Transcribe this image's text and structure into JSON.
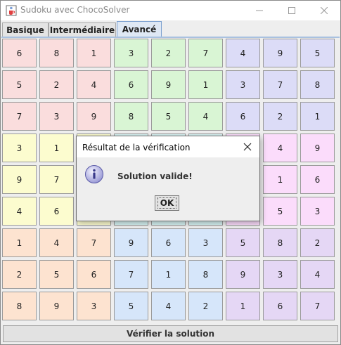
{
  "window": {
    "title": "Sudoku avec ChocoSolver",
    "icon": "java-coffee-cup-icon"
  },
  "tabs": [
    {
      "label": "Basique",
      "active": false
    },
    {
      "label": "Intermédiaire",
      "active": false
    },
    {
      "label": "Avancé",
      "active": true
    }
  ],
  "grid": {
    "rows": [
      [
        "6",
        "8",
        "1",
        "3",
        "2",
        "7",
        "4",
        "9",
        "5"
      ],
      [
        "5",
        "2",
        "4",
        "6",
        "9",
        "1",
        "3",
        "7",
        "8"
      ],
      [
        "7",
        "3",
        "9",
        "8",
        "5",
        "4",
        "6",
        "2",
        "1"
      ],
      [
        "3",
        "1",
        "",
        "",
        "",
        "",
        "",
        "4",
        "9"
      ],
      [
        "9",
        "7",
        "",
        "",
        "",
        "",
        "",
        "1",
        "6"
      ],
      [
        "4",
        "6",
        "",
        "",
        "",
        "",
        "",
        "5",
        "3"
      ],
      [
        "1",
        "4",
        "7",
        "9",
        "6",
        "3",
        "5",
        "8",
        "2"
      ],
      [
        "2",
        "5",
        "6",
        "7",
        "1",
        "8",
        "9",
        "3",
        "4"
      ],
      [
        "8",
        "9",
        "3",
        "5",
        "4",
        "2",
        "1",
        "6",
        "7"
      ]
    ],
    "block_colors": [
      [
        "#fadddd",
        "#d9f5d4",
        "#dcdcf7"
      ],
      [
        "#fcfccf",
        "#d6f2f2",
        "#fbdcfb"
      ],
      [
        "#fde3d0",
        "#d6e6fa",
        "#e5d7f5"
      ]
    ]
  },
  "verify_button": {
    "label": "Vérifier la solution"
  },
  "dialog": {
    "title": "Résultat de la vérification",
    "message": "Solution valide!",
    "ok_label": "OK",
    "icon": "info-icon"
  }
}
